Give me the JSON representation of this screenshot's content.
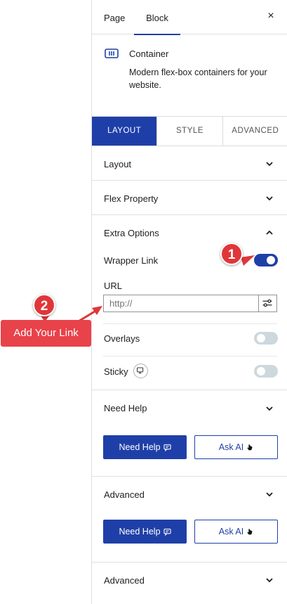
{
  "header": {
    "tabs": [
      {
        "label": "Page"
      },
      {
        "label": "Block"
      }
    ],
    "close_icon": "×"
  },
  "block": {
    "icon": "container-icon",
    "title": "Container",
    "description": "Modern flex-box containers for your website."
  },
  "subtabs": [
    {
      "label": "LAYOUT",
      "active": true
    },
    {
      "label": "STYLE",
      "active": false
    },
    {
      "label": "ADVANCED",
      "active": false
    }
  ],
  "sections": {
    "layout": "Layout",
    "flex_property": "Flex Property",
    "extra_options": "Extra Options",
    "need_help": "Need Help",
    "advanced_1": "Advanced",
    "advanced_2": "Advanced"
  },
  "extra_options": {
    "wrapper_link_label": "Wrapper Link",
    "wrapper_link_on": true,
    "url_label": "URL",
    "url_placeholder": "http://",
    "url_value": "",
    "overlays_label": "Overlays",
    "overlays_on": false,
    "sticky_label": "Sticky",
    "sticky_on": false
  },
  "buttons": {
    "need_help": "Need Help",
    "ask_ai": "Ask AI"
  },
  "annotations": {
    "badge_1": "1",
    "badge_2": "2",
    "callout": "Add Your Link"
  },
  "colors": {
    "accent": "#1f3fa8",
    "toggle_off": "#ccd8dd",
    "annotation_red": "#e0363a"
  }
}
